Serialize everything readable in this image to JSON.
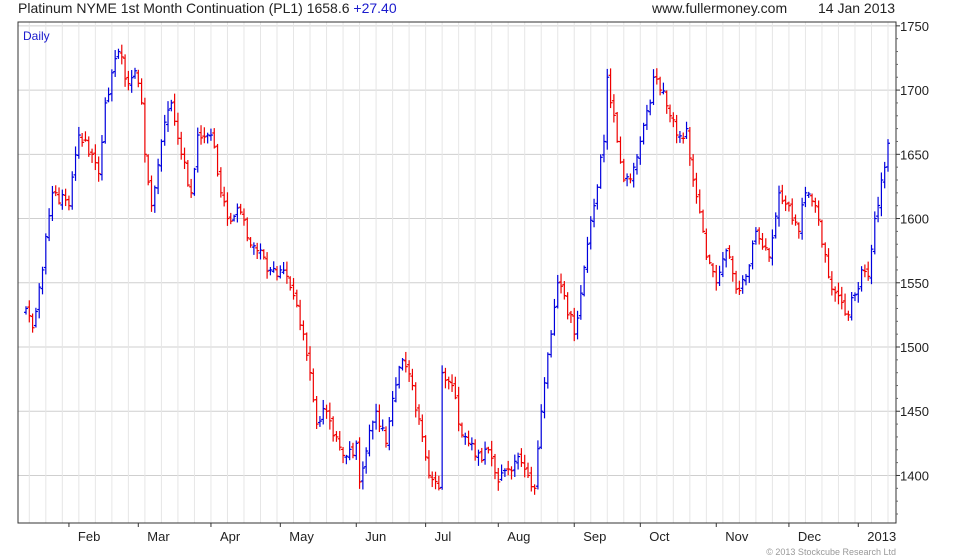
{
  "header": {
    "instrument": "Platinum NYME 1st Month Continuation (PL1)",
    "last_price": "1658.6",
    "change": "+27.40",
    "site": "www.fullermoney.com",
    "date": "14 Jan 2013"
  },
  "footer": {
    "copyright": "© 2013 Stockcube Research Ltd"
  },
  "chart_data": {
    "type": "ohlc",
    "period": "Daily",
    "up_color": "#0000dd",
    "down_color": "#ee0000",
    "ylim": [
      1363,
      1753
    ],
    "yticks": [
      1400,
      1450,
      1500,
      1550,
      1600,
      1650,
      1700,
      1750
    ],
    "xlabels": [
      "Feb",
      "Mar",
      "Apr",
      "May",
      "Jun",
      "Jul",
      "Aug",
      "Sep",
      "Oct",
      "Nov",
      "Dec",
      "2013"
    ],
    "grid": true,
    "y_axis_side": "right",
    "anchors": [
      [
        "2012-01-13",
        1530
      ],
      [
        "2012-01-17",
        1515
      ],
      [
        "2012-01-20",
        1560
      ],
      [
        "2012-01-25",
        1620
      ],
      [
        "2012-02-01",
        1610
      ],
      [
        "2012-02-06",
        1665
      ],
      [
        "2012-02-10",
        1650
      ],
      [
        "2012-02-14",
        1635
      ],
      [
        "2012-02-16",
        1690
      ],
      [
        "2012-02-22",
        1730
      ],
      [
        "2012-02-27",
        1705
      ],
      [
        "2012-02-29",
        1715
      ],
      [
        "2012-03-02",
        1690
      ],
      [
        "2012-03-05",
        1650
      ],
      [
        "2012-03-07",
        1610
      ],
      [
        "2012-03-12",
        1660
      ],
      [
        "2012-03-15",
        1690
      ],
      [
        "2012-03-20",
        1650
      ],
      [
        "2012-03-23",
        1620
      ],
      [
        "2012-03-27",
        1665
      ],
      [
        "2012-04-02",
        1665
      ],
      [
        "2012-04-05",
        1620
      ],
      [
        "2012-04-09",
        1600
      ],
      [
        "2012-04-13",
        1605
      ],
      [
        "2012-04-17",
        1585
      ],
      [
        "2012-04-20",
        1575
      ],
      [
        "2012-04-26",
        1560
      ],
      [
        "2012-05-01",
        1560
      ],
      [
        "2012-05-03",
        1555
      ],
      [
        "2012-05-07",
        1540
      ],
      [
        "2012-05-10",
        1510
      ],
      [
        "2012-05-14",
        1480
      ],
      [
        "2012-05-16",
        1440
      ],
      [
        "2012-05-21",
        1450
      ],
      [
        "2012-05-24",
        1430
      ],
      [
        "2012-05-29",
        1415
      ],
      [
        "2012-06-01",
        1425
      ],
      [
        "2012-06-04",
        1395
      ],
      [
        "2012-06-07",
        1435
      ],
      [
        "2012-06-11",
        1450
      ],
      [
        "2012-06-14",
        1425
      ],
      [
        "2012-06-18",
        1460
      ],
      [
        "2012-06-21",
        1490
      ],
      [
        "2012-06-26",
        1470
      ],
      [
        "2012-06-29",
        1430
      ],
      [
        "2012-07-03",
        1400
      ],
      [
        "2012-07-06",
        1390
      ],
      [
        "2012-07-09",
        1480
      ],
      [
        "2012-07-12",
        1470
      ],
      [
        "2012-07-16",
        1440
      ],
      [
        "2012-07-19",
        1425
      ],
      [
        "2012-07-23",
        1415
      ],
      [
        "2012-07-27",
        1420
      ],
      [
        "2012-08-01",
        1395
      ],
      [
        "2012-08-06",
        1405
      ],
      [
        "2012-08-10",
        1410
      ],
      [
        "2012-08-14",
        1400
      ],
      [
        "2012-08-16",
        1390
      ],
      [
        "2012-08-20",
        1450
      ],
      [
        "2012-08-23",
        1510
      ],
      [
        "2012-08-27",
        1550
      ],
      [
        "2012-08-29",
        1540
      ],
      [
        "2012-09-03",
        1510
      ],
      [
        "2012-09-07",
        1580
      ],
      [
        "2012-09-11",
        1610
      ],
      [
        "2012-09-14",
        1660
      ],
      [
        "2012-09-17",
        1710
      ],
      [
        "2012-09-20",
        1660
      ],
      [
        "2012-09-24",
        1630
      ],
      [
        "2012-09-27",
        1640
      ],
      [
        "2012-10-01",
        1660
      ],
      [
        "2012-10-04",
        1690
      ],
      [
        "2012-10-05",
        1710
      ],
      [
        "2012-10-09",
        1700
      ],
      [
        "2012-10-12",
        1680
      ],
      [
        "2012-10-16",
        1665
      ],
      [
        "2012-10-19",
        1670
      ],
      [
        "2012-10-23",
        1630
      ],
      [
        "2012-10-26",
        1590
      ],
      [
        "2012-10-29",
        1570
      ],
      [
        "2012-11-01",
        1550
      ],
      [
        "2012-11-06",
        1575
      ],
      [
        "2012-11-09",
        1545
      ],
      [
        "2012-11-14",
        1555
      ],
      [
        "2012-11-19",
        1590
      ],
      [
        "2012-11-23",
        1570
      ],
      [
        "2012-11-28",
        1620
      ],
      [
        "2012-12-03",
        1610
      ],
      [
        "2012-12-06",
        1590
      ],
      [
        "2012-12-10",
        1620
      ],
      [
        "2012-12-13",
        1610
      ],
      [
        "2012-12-17",
        1580
      ],
      [
        "2012-12-20",
        1545
      ],
      [
        "2012-12-24",
        1540
      ],
      [
        "2012-12-27",
        1525
      ],
      [
        "2013-01-02",
        1560
      ],
      [
        "2013-01-04",
        1555
      ],
      [
        "2013-01-08",
        1600
      ],
      [
        "2013-01-10",
        1630
      ],
      [
        "2013-01-14",
        1658.6
      ]
    ]
  }
}
